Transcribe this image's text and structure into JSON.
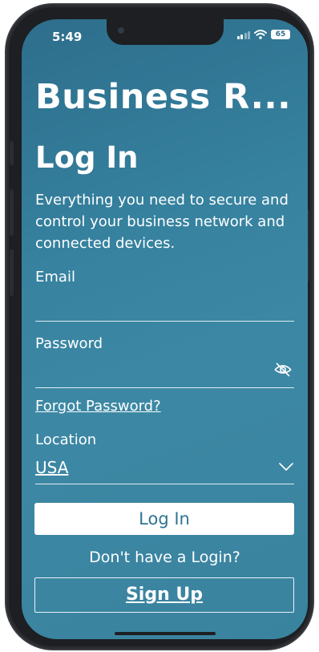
{
  "status_bar": {
    "time": "5:49",
    "battery": "65"
  },
  "app": {
    "title": "Business R..."
  },
  "login": {
    "heading": "Log In",
    "subtitle": "Everything you need to secure and control your business network and connected devices.",
    "email_label": "Email",
    "email_value": "",
    "password_label": "Password",
    "password_value": "",
    "forgot_password": "Forgot Password?",
    "location_label": "Location",
    "location_value": "USA",
    "login_button": "Log In",
    "no_login_text": "Don't have a Login?",
    "signup_button": "Sign Up"
  },
  "colors": {
    "background": "#36829f",
    "button_text": "#2f7593",
    "text": "#ffffff"
  },
  "icons": {
    "password_toggle": "eye-off-icon",
    "location_dropdown": "chevron-down-icon",
    "signal": "cellular-signal-icon",
    "wifi": "wifi-icon",
    "battery": "battery-icon"
  }
}
